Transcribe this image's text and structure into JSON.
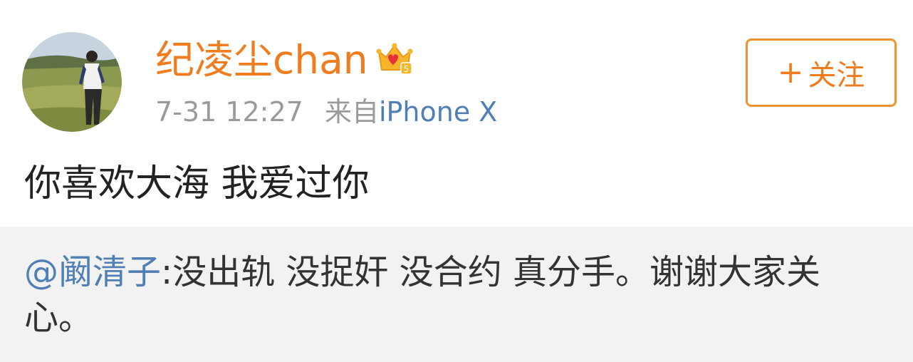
{
  "post": {
    "author": {
      "name": "纪凌尘chan",
      "avatar_icon": "user-avatar-photo",
      "badge_icon": "vip-crown-icon",
      "badge_level": "5"
    },
    "timestamp": "7-31 12:27",
    "source_prefix": "来自",
    "source_device": "iPhone X",
    "follow_button": {
      "plus": "+",
      "label": "关注"
    },
    "text": "你喜欢大海 我爱过你"
  },
  "repost": {
    "mention": "@阚清子",
    "text": ":没出轨 没捉奸 没合约 真分手。谢谢大家关心。"
  },
  "colors": {
    "username": "#ef7d1f",
    "link": "#4f7fb5",
    "meta": "#9a9a9a",
    "follow_border": "#f0922e",
    "repost_bg": "#f2f2f2"
  }
}
